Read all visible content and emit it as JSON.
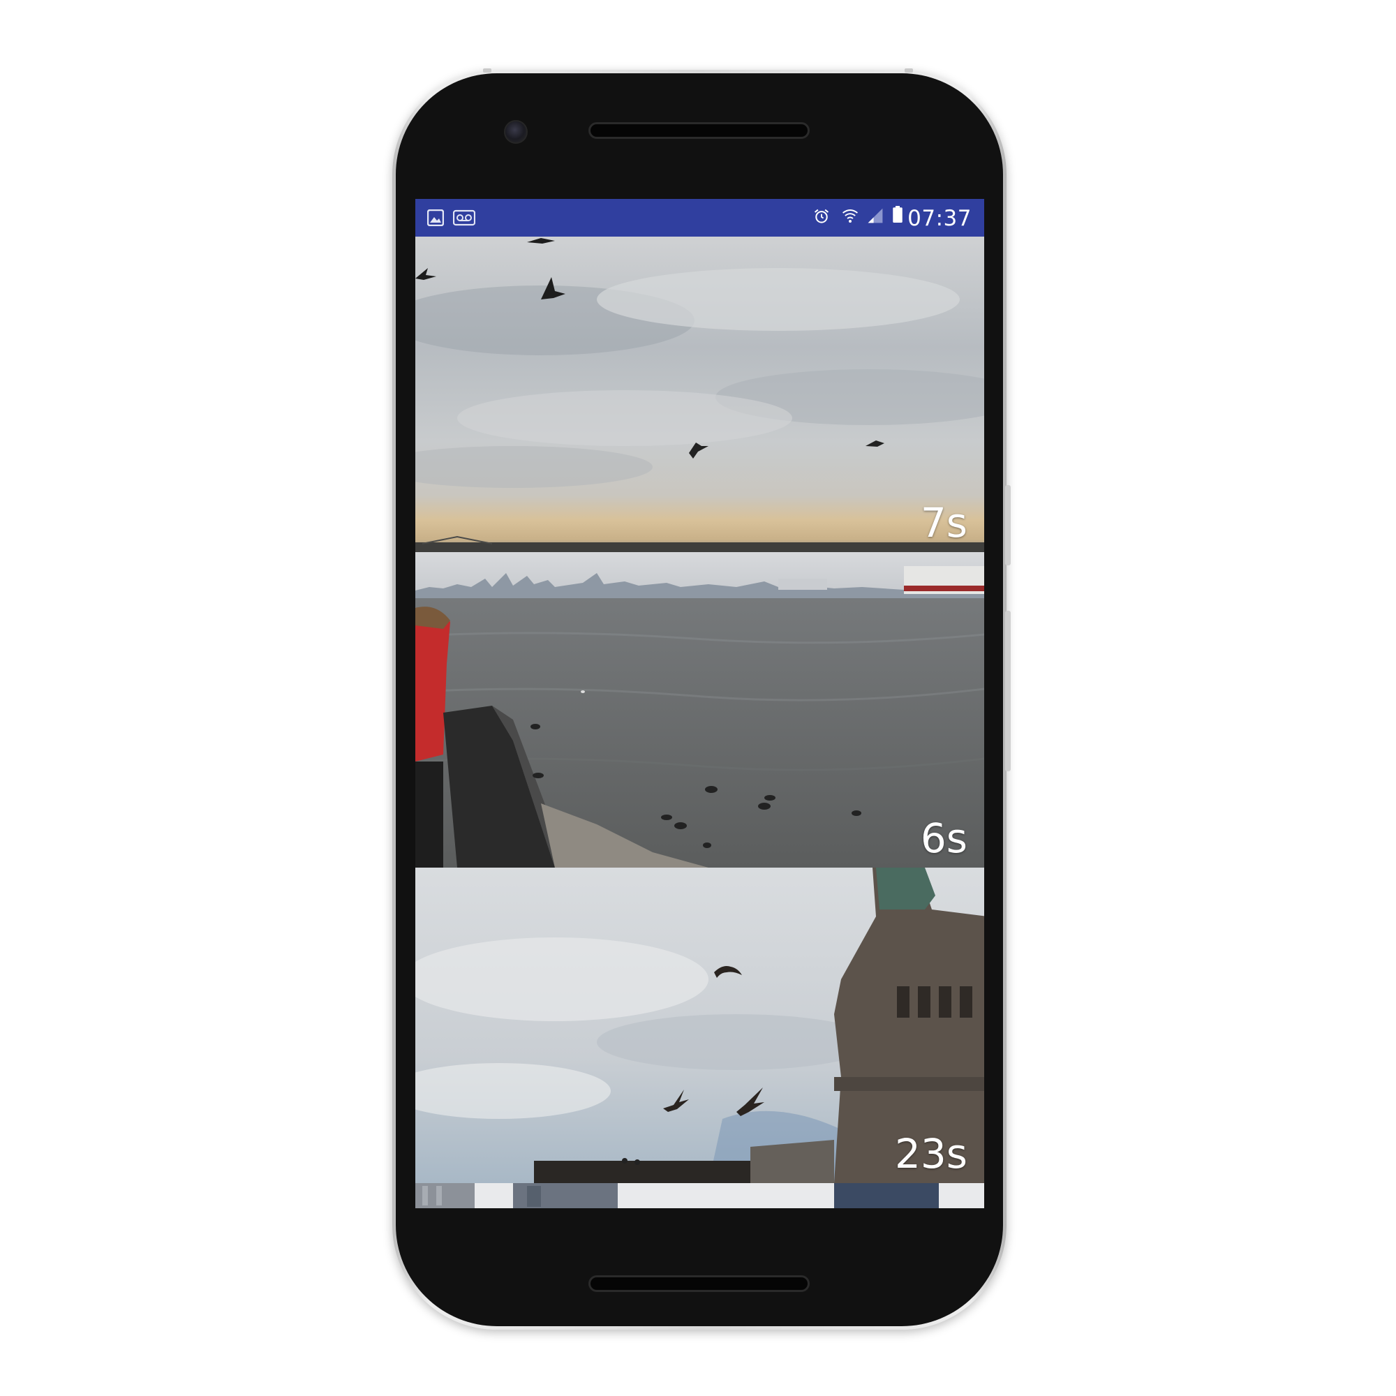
{
  "status_bar": {
    "time": "07:37",
    "background_color": "#303f9f",
    "left_icons": [
      "gallery-notification-icon",
      "voicemail-icon"
    ],
    "right_icons": [
      "alarm-icon",
      "wifi-icon",
      "cell-signal-icon",
      "battery-icon"
    ]
  },
  "feed": {
    "videos": [
      {
        "duration": "7s",
        "scene": "seagulls-cloudy-sky"
      },
      {
        "duration": "6s",
        "scene": "harbor-water-ducks"
      },
      {
        "duration": "23s",
        "scene": "statue-of-liberty-pedestal-birds"
      },
      {
        "duration": "",
        "scene": "city-buildings-partial"
      }
    ]
  }
}
